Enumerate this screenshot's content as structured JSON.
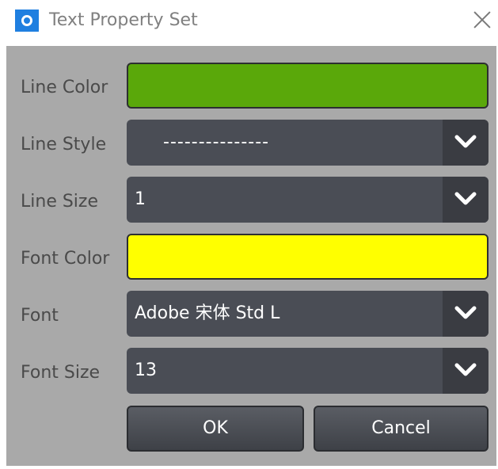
{
  "window": {
    "title": "Text Property Set",
    "icon": "app-ring-icon",
    "close_icon": "close-icon"
  },
  "fields": {
    "line_color": {
      "label": "Line Color",
      "value": "#5aa80a"
    },
    "line_style": {
      "label": "Line Style",
      "value": "---------------"
    },
    "line_size": {
      "label": "Line Size",
      "value": "1"
    },
    "font_color": {
      "label": "Font Color",
      "value": "#ffff00"
    },
    "font": {
      "label": "Font",
      "value": "Adobe 宋体 Std L"
    },
    "font_size": {
      "label": "Font Size",
      "value": "13"
    }
  },
  "buttons": {
    "ok": "OK",
    "cancel": "Cancel"
  },
  "colors": {
    "panel_bg": "#a9a9a9",
    "control_bg": "#4a4d55",
    "app_icon": "#1f7fe0"
  }
}
